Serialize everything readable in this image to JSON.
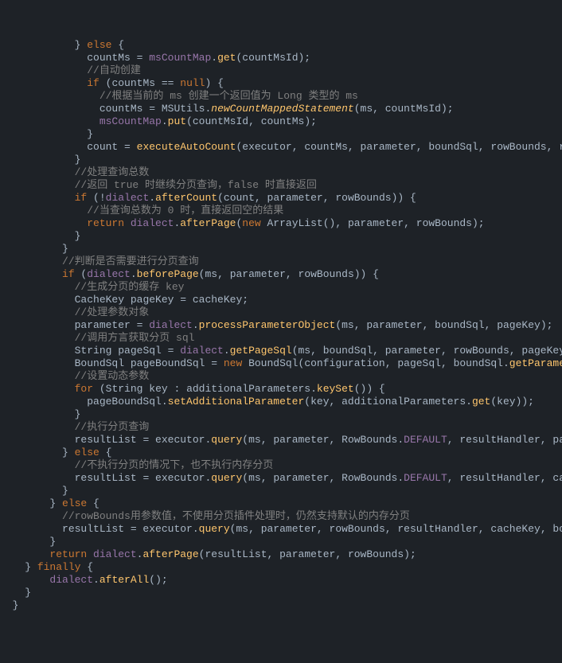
{
  "code_lines": [
    {
      "i": 12,
      "t": [
        {
          "c": "pn",
          "s": "} "
        },
        {
          "c": "kw",
          "s": "else"
        },
        {
          "c": "pn",
          "s": " {"
        }
      ]
    },
    {
      "i": 14,
      "t": [
        {
          "c": "id",
          "s": "countMs = "
        },
        {
          "c": "fld",
          "s": "msCountMap"
        },
        {
          "c": "pn",
          "s": "."
        },
        {
          "c": "mth",
          "s": "get"
        },
        {
          "c": "pn",
          "s": "("
        },
        {
          "c": "id",
          "s": "countMsId"
        },
        {
          "c": "pn",
          "s": ");"
        }
      ]
    },
    {
      "i": 14,
      "t": [
        {
          "c": "cmt",
          "s": "//自动创建"
        }
      ]
    },
    {
      "i": 14,
      "t": [
        {
          "c": "kw",
          "s": "if "
        },
        {
          "c": "pn",
          "s": "("
        },
        {
          "c": "id",
          "s": "countMs == "
        },
        {
          "c": "kw",
          "s": "null"
        },
        {
          "c": "pn",
          "s": ") {"
        }
      ]
    },
    {
      "i": 16,
      "t": [
        {
          "c": "cmt",
          "s": "//根据当前的 ms 创建一个返回值为 Long 类型的 ms"
        }
      ]
    },
    {
      "i": 16,
      "t": [
        {
          "c": "id",
          "s": "countMs = MSUtils."
        },
        {
          "c": "stc",
          "s": "newCountMappedStatement"
        },
        {
          "c": "pn",
          "s": "("
        },
        {
          "c": "id",
          "s": "ms"
        },
        {
          "c": "pn",
          "s": ", "
        },
        {
          "c": "id",
          "s": "countMsId"
        },
        {
          "c": "pn",
          "s": ");"
        }
      ]
    },
    {
      "i": 16,
      "t": [
        {
          "c": "fld",
          "s": "msCountMap"
        },
        {
          "c": "pn",
          "s": "."
        },
        {
          "c": "mth",
          "s": "put"
        },
        {
          "c": "pn",
          "s": "("
        },
        {
          "c": "id",
          "s": "countMsId"
        },
        {
          "c": "pn",
          "s": ", "
        },
        {
          "c": "id",
          "s": "countMs"
        },
        {
          "c": "pn",
          "s": ");"
        }
      ]
    },
    {
      "i": 14,
      "t": [
        {
          "c": "pn",
          "s": "}"
        }
      ]
    },
    {
      "i": 14,
      "t": [
        {
          "c": "id",
          "s": "count = "
        },
        {
          "c": "mth",
          "s": "executeAutoCount"
        },
        {
          "c": "pn",
          "s": "("
        },
        {
          "c": "id",
          "s": "executor"
        },
        {
          "c": "pn",
          "s": ", "
        },
        {
          "c": "id",
          "s": "countMs"
        },
        {
          "c": "pn",
          "s": ", "
        },
        {
          "c": "id",
          "s": "parameter"
        },
        {
          "c": "pn",
          "s": ", "
        },
        {
          "c": "id",
          "s": "boundSql"
        },
        {
          "c": "pn",
          "s": ", "
        },
        {
          "c": "id",
          "s": "rowBounds"
        },
        {
          "c": "pn",
          "s": ", "
        },
        {
          "c": "id",
          "s": "resultH"
        }
      ]
    },
    {
      "i": 12,
      "t": [
        {
          "c": "pn",
          "s": "}"
        }
      ]
    },
    {
      "i": 12,
      "t": [
        {
          "c": "cmt",
          "s": "//处理查询总数"
        }
      ]
    },
    {
      "i": 12,
      "t": [
        {
          "c": "cmt",
          "s": "//返回 true 时继续分页查询，false 时直接返回"
        }
      ]
    },
    {
      "i": 12,
      "t": [
        {
          "c": "kw",
          "s": "if "
        },
        {
          "c": "pn",
          "s": "(!"
        },
        {
          "c": "fld",
          "s": "dialect"
        },
        {
          "c": "pn",
          "s": "."
        },
        {
          "c": "mth",
          "s": "afterCount"
        },
        {
          "c": "pn",
          "s": "("
        },
        {
          "c": "id",
          "s": "count"
        },
        {
          "c": "pn",
          "s": ", "
        },
        {
          "c": "id",
          "s": "parameter"
        },
        {
          "c": "pn",
          "s": ", "
        },
        {
          "c": "id",
          "s": "rowBounds"
        },
        {
          "c": "pn",
          "s": ")) {"
        }
      ]
    },
    {
      "i": 14,
      "t": [
        {
          "c": "cmt",
          "s": "//当查询总数为 0 时，直接返回空的结果"
        }
      ]
    },
    {
      "i": 14,
      "t": [
        {
          "c": "kw",
          "s": "return "
        },
        {
          "c": "fld",
          "s": "dialect"
        },
        {
          "c": "pn",
          "s": "."
        },
        {
          "c": "mth",
          "s": "afterPage"
        },
        {
          "c": "pn",
          "s": "("
        },
        {
          "c": "kw",
          "s": "new "
        },
        {
          "c": "id",
          "s": "ArrayList"
        },
        {
          "c": "pn",
          "s": "(), "
        },
        {
          "c": "id",
          "s": "parameter"
        },
        {
          "c": "pn",
          "s": ", "
        },
        {
          "c": "id",
          "s": "rowBounds"
        },
        {
          "c": "pn",
          "s": ");"
        }
      ]
    },
    {
      "i": 12,
      "t": [
        {
          "c": "pn",
          "s": "}"
        }
      ]
    },
    {
      "i": 10,
      "t": [
        {
          "c": "pn",
          "s": "}"
        }
      ]
    },
    {
      "i": 10,
      "t": [
        {
          "c": "cmt",
          "s": "//判断是否需要进行分页查询"
        }
      ]
    },
    {
      "i": 10,
      "t": [
        {
          "c": "kw",
          "s": "if "
        },
        {
          "c": "pn",
          "s": "("
        },
        {
          "c": "fld",
          "s": "dialect"
        },
        {
          "c": "pn",
          "s": "."
        },
        {
          "c": "mth",
          "s": "beforePage"
        },
        {
          "c": "pn",
          "s": "("
        },
        {
          "c": "id",
          "s": "ms"
        },
        {
          "c": "pn",
          "s": ", "
        },
        {
          "c": "id",
          "s": "parameter"
        },
        {
          "c": "pn",
          "s": ", "
        },
        {
          "c": "id",
          "s": "rowBounds"
        },
        {
          "c": "pn",
          "s": ")) {"
        }
      ]
    },
    {
      "i": 12,
      "t": [
        {
          "c": "cmt",
          "s": "//生成分页的缓存 key"
        }
      ]
    },
    {
      "i": 12,
      "t": [
        {
          "c": "id",
          "s": "CacheKey pageKey = cacheKey;"
        }
      ]
    },
    {
      "i": 12,
      "t": [
        {
          "c": "cmt",
          "s": "//处理参数对象"
        }
      ]
    },
    {
      "i": 12,
      "t": [
        {
          "c": "id",
          "s": "parameter = "
        },
        {
          "c": "fld",
          "s": "dialect"
        },
        {
          "c": "pn",
          "s": "."
        },
        {
          "c": "mth",
          "s": "processParameterObject"
        },
        {
          "c": "pn",
          "s": "("
        },
        {
          "c": "id",
          "s": "ms"
        },
        {
          "c": "pn",
          "s": ", "
        },
        {
          "c": "id",
          "s": "parameter"
        },
        {
          "c": "pn",
          "s": ", "
        },
        {
          "c": "id",
          "s": "boundSql"
        },
        {
          "c": "pn",
          "s": ", "
        },
        {
          "c": "id",
          "s": "pageKey"
        },
        {
          "c": "pn",
          "s": ");"
        }
      ]
    },
    {
      "i": 12,
      "t": [
        {
          "c": "cmt",
          "s": "//调用方言获取分页 sql"
        }
      ]
    },
    {
      "i": 12,
      "t": [
        {
          "c": "id",
          "s": "String pageSql = "
        },
        {
          "c": "fld",
          "s": "dialect"
        },
        {
          "c": "pn",
          "s": "."
        },
        {
          "c": "mth",
          "s": "getPageSql"
        },
        {
          "c": "pn",
          "s": "("
        },
        {
          "c": "id",
          "s": "ms"
        },
        {
          "c": "pn",
          "s": ", "
        },
        {
          "c": "id",
          "s": "boundSql"
        },
        {
          "c": "pn",
          "s": ", "
        },
        {
          "c": "id",
          "s": "parameter"
        },
        {
          "c": "pn",
          "s": ", "
        },
        {
          "c": "id",
          "s": "rowBounds"
        },
        {
          "c": "pn",
          "s": ", "
        },
        {
          "c": "id",
          "s": "pageKey"
        },
        {
          "c": "pn",
          "s": ");"
        }
      ]
    },
    {
      "i": 12,
      "t": [
        {
          "c": "id",
          "s": "BoundSql pageBoundSql = "
        },
        {
          "c": "kw",
          "s": "new "
        },
        {
          "c": "id",
          "s": "BoundSql"
        },
        {
          "c": "pn",
          "s": "("
        },
        {
          "c": "id",
          "s": "configuration"
        },
        {
          "c": "pn",
          "s": ", "
        },
        {
          "c": "id",
          "s": "pageSql"
        },
        {
          "c": "pn",
          "s": ", "
        },
        {
          "c": "id",
          "s": "boundSql."
        },
        {
          "c": "mth",
          "s": "getParameterMapp"
        }
      ]
    },
    {
      "i": 12,
      "t": [
        {
          "c": "cmt",
          "s": "//设置动态参数"
        }
      ]
    },
    {
      "i": 12,
      "t": [
        {
          "c": "kw",
          "s": "for "
        },
        {
          "c": "pn",
          "s": "("
        },
        {
          "c": "id",
          "s": "String key : additionalParameters."
        },
        {
          "c": "mth",
          "s": "keySet"
        },
        {
          "c": "pn",
          "s": "()) {"
        }
      ]
    },
    {
      "i": 14,
      "t": [
        {
          "c": "id",
          "s": "pageBoundSql."
        },
        {
          "c": "mth",
          "s": "setAdditionalParameter"
        },
        {
          "c": "pn",
          "s": "("
        },
        {
          "c": "id",
          "s": "key"
        },
        {
          "c": "pn",
          "s": ", "
        },
        {
          "c": "id",
          "s": "additionalParameters."
        },
        {
          "c": "mth",
          "s": "get"
        },
        {
          "c": "pn",
          "s": "("
        },
        {
          "c": "id",
          "s": "key"
        },
        {
          "c": "pn",
          "s": "));"
        }
      ]
    },
    {
      "i": 12,
      "t": [
        {
          "c": "pn",
          "s": "}"
        }
      ]
    },
    {
      "i": 12,
      "t": [
        {
          "c": "cmt",
          "s": "//执行分页查询"
        }
      ]
    },
    {
      "i": 12,
      "t": [
        {
          "c": "id",
          "s": "resultList = executor."
        },
        {
          "c": "mth",
          "s": "query"
        },
        {
          "c": "pn",
          "s": "("
        },
        {
          "c": "id",
          "s": "ms"
        },
        {
          "c": "pn",
          "s": ", "
        },
        {
          "c": "id",
          "s": "parameter"
        },
        {
          "c": "pn",
          "s": ", "
        },
        {
          "c": "id",
          "s": "RowBounds."
        },
        {
          "c": "fld",
          "s": "DEFAULT"
        },
        {
          "c": "pn",
          "s": ", "
        },
        {
          "c": "id",
          "s": "resultHandler"
        },
        {
          "c": "pn",
          "s": ", "
        },
        {
          "c": "id",
          "s": "pageKey"
        },
        {
          "c": "pn",
          "s": ", "
        }
      ]
    },
    {
      "i": 10,
      "t": [
        {
          "c": "pn",
          "s": "} "
        },
        {
          "c": "kw",
          "s": "else"
        },
        {
          "c": "pn",
          "s": " {"
        }
      ]
    },
    {
      "i": 12,
      "t": [
        {
          "c": "cmt",
          "s": "//不执行分页的情况下，也不执行内存分页"
        }
      ]
    },
    {
      "i": 12,
      "t": [
        {
          "c": "id",
          "s": "resultList = executor."
        },
        {
          "c": "mth",
          "s": "query"
        },
        {
          "c": "pn",
          "s": "("
        },
        {
          "c": "id",
          "s": "ms"
        },
        {
          "c": "pn",
          "s": ", "
        },
        {
          "c": "id",
          "s": "parameter"
        },
        {
          "c": "pn",
          "s": ", "
        },
        {
          "c": "id",
          "s": "RowBounds."
        },
        {
          "c": "fld",
          "s": "DEFAULT"
        },
        {
          "c": "pn",
          "s": ", "
        },
        {
          "c": "id",
          "s": "resultHandler"
        },
        {
          "c": "pn",
          "s": ", "
        },
        {
          "c": "id",
          "s": "cacheKey"
        },
        {
          "c": "pn",
          "s": ", "
        }
      ]
    },
    {
      "i": 10,
      "t": [
        {
          "c": "pn",
          "s": "}"
        }
      ]
    },
    {
      "i": 8,
      "t": [
        {
          "c": "pn",
          "s": "} "
        },
        {
          "c": "kw",
          "s": "else"
        },
        {
          "c": "pn",
          "s": " {"
        }
      ]
    },
    {
      "i": 10,
      "t": [
        {
          "c": "cmt",
          "s": "//rowBounds用参数值，不使用分页插件处理时，仍然支持默认的内存分页"
        }
      ]
    },
    {
      "i": 10,
      "t": [
        {
          "c": "id",
          "s": "resultList = executor."
        },
        {
          "c": "mth",
          "s": "query"
        },
        {
          "c": "pn",
          "s": "("
        },
        {
          "c": "id",
          "s": "ms"
        },
        {
          "c": "pn",
          "s": ", "
        },
        {
          "c": "id",
          "s": "parameter"
        },
        {
          "c": "pn",
          "s": ", "
        },
        {
          "c": "id",
          "s": "rowBounds"
        },
        {
          "c": "pn",
          "s": ", "
        },
        {
          "c": "id",
          "s": "resultHandler"
        },
        {
          "c": "pn",
          "s": ", "
        },
        {
          "c": "id",
          "s": "cacheKey"
        },
        {
          "c": "pn",
          "s": ", "
        },
        {
          "c": "id",
          "s": "boundSql"
        },
        {
          "c": "pn",
          "s": ");"
        }
      ]
    },
    {
      "i": 8,
      "t": [
        {
          "c": "pn",
          "s": "}"
        }
      ]
    },
    {
      "i": 8,
      "t": [
        {
          "c": "kw",
          "s": "return "
        },
        {
          "c": "fld",
          "s": "dialect"
        },
        {
          "c": "pn",
          "s": "."
        },
        {
          "c": "mth",
          "s": "afterPage"
        },
        {
          "c": "pn",
          "s": "("
        },
        {
          "c": "id",
          "s": "resultList"
        },
        {
          "c": "pn",
          "s": ", "
        },
        {
          "c": "id",
          "s": "parameter"
        },
        {
          "c": "pn",
          "s": ", "
        },
        {
          "c": "id",
          "s": "rowBounds"
        },
        {
          "c": "pn",
          "s": ");"
        }
      ]
    },
    {
      "i": 4,
      "t": [
        {
          "c": "pn",
          "s": "} "
        },
        {
          "c": "kw",
          "s": "finally"
        },
        {
          "c": "pn",
          "s": " {"
        }
      ]
    },
    {
      "i": 8,
      "t": [
        {
          "c": "fld",
          "s": "dialect"
        },
        {
          "c": "pn",
          "s": "."
        },
        {
          "c": "mth",
          "s": "afterAll"
        },
        {
          "c": "pn",
          "s": "();"
        }
      ]
    },
    {
      "i": 4,
      "t": [
        {
          "c": "pn",
          "s": "}"
        }
      ]
    },
    {
      "i": 2,
      "t": [
        {
          "c": "pn",
          "s": "}"
        }
      ]
    }
  ]
}
